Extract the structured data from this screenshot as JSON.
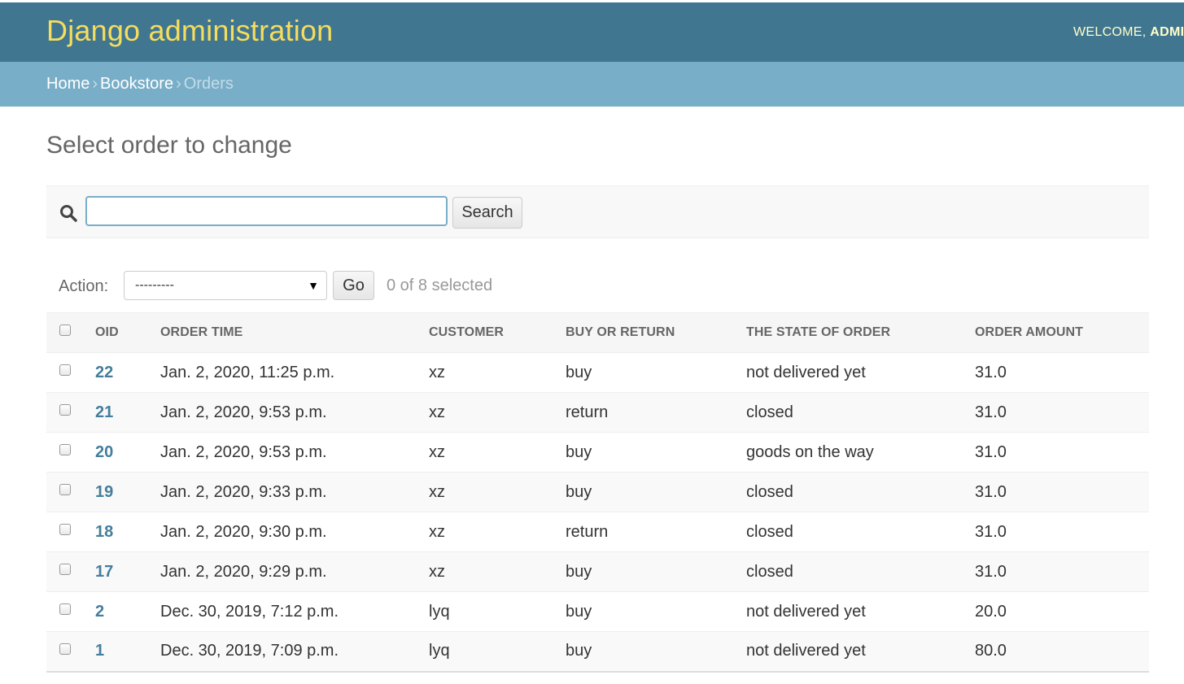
{
  "header": {
    "branding": "Django administration",
    "welcome": "WELCOME,",
    "username": "ADMIN"
  },
  "breadcrumbs": {
    "home": "Home",
    "app": "Bookstore",
    "current": "Orders",
    "separator": "›"
  },
  "page": {
    "title": "Select order to change"
  },
  "search": {
    "value": "",
    "placeholder": "",
    "button_label": "Search"
  },
  "actions": {
    "label": "Action:",
    "selected_option": "---------",
    "go_label": "Go",
    "counter": "0 of 8 selected"
  },
  "table": {
    "columns": [
      "OID",
      "ORDER TIME",
      "CUSTOMER",
      "BUY OR RETURN",
      "THE STATE OF ORDER",
      "ORDER AMOUNT"
    ],
    "rows": [
      {
        "oid": "22",
        "time": "Jan. 2, 2020, 11:25 p.m.",
        "customer": "xz",
        "type": "buy",
        "state": "not delivered yet",
        "amount": "31.0"
      },
      {
        "oid": "21",
        "time": "Jan. 2, 2020, 9:53 p.m.",
        "customer": "xz",
        "type": "return",
        "state": "closed",
        "amount": "31.0"
      },
      {
        "oid": "20",
        "time": "Jan. 2, 2020, 9:53 p.m.",
        "customer": "xz",
        "type": "buy",
        "state": "goods on the way",
        "amount": "31.0"
      },
      {
        "oid": "19",
        "time": "Jan. 2, 2020, 9:33 p.m.",
        "customer": "xz",
        "type": "buy",
        "state": "closed",
        "amount": "31.0"
      },
      {
        "oid": "18",
        "time": "Jan. 2, 2020, 9:30 p.m.",
        "customer": "xz",
        "type": "return",
        "state": "closed",
        "amount": "31.0"
      },
      {
        "oid": "17",
        "time": "Jan. 2, 2020, 9:29 p.m.",
        "customer": "xz",
        "type": "buy",
        "state": "closed",
        "amount": "31.0"
      },
      {
        "oid": "2",
        "time": "Dec. 30, 2019, 7:12 p.m.",
        "customer": "lyq",
        "type": "buy",
        "state": "not delivered yet",
        "amount": "20.0"
      },
      {
        "oid": "1",
        "time": "Dec. 30, 2019, 7:09 p.m.",
        "customer": "lyq",
        "type": "buy",
        "state": "not delivered yet",
        "amount": "80.0"
      }
    ]
  },
  "colors": {
    "header_bg": "#417690",
    "branding": "#f5dd5d",
    "breadcrumbs_bg": "#79aec8",
    "link": "#447e9b"
  },
  "icons": {
    "search": "search-icon",
    "select_arrow": "caret-down-icon"
  }
}
